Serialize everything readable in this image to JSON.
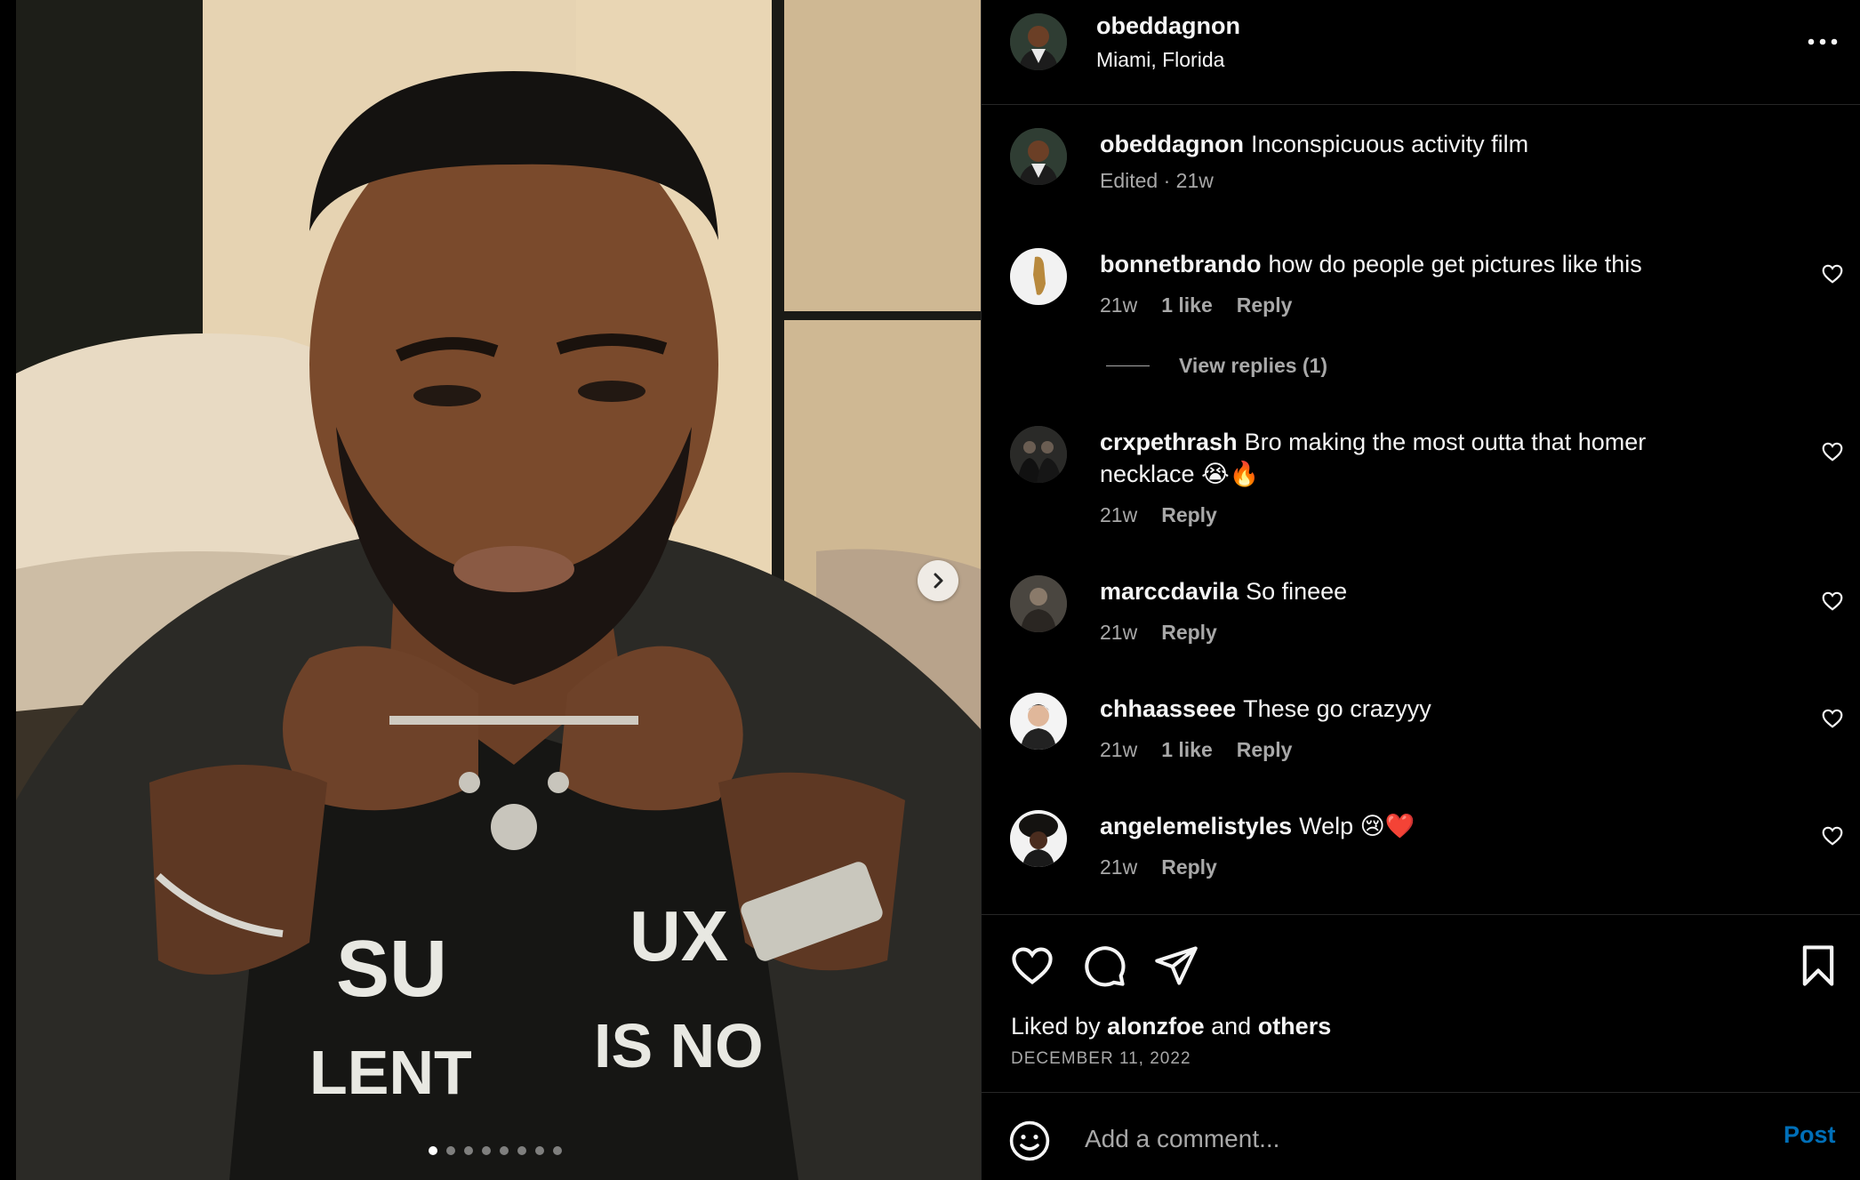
{
  "post": {
    "username": "obeddagnon",
    "location": "Miami, Florida",
    "caption_user": "obeddagnon",
    "caption_text": "Inconspicuous activity film",
    "caption_meta": "Edited · 21w"
  },
  "comments": [
    {
      "user": "bonnetbrando",
      "text": "how do people get pictures like this",
      "age": "21w",
      "likes": "1 like",
      "reply": "Reply"
    },
    {
      "user": "crxpethrash",
      "text": "Bro making the most outta that homer necklace 😭🔥",
      "age": "21w",
      "likes": "",
      "reply": "Reply"
    },
    {
      "user": "marccdavila",
      "text": "So fineee",
      "age": "21w",
      "likes": "",
      "reply": "Reply"
    },
    {
      "user": "chhaasseee",
      "text": "These go crazyyy",
      "age": "21w",
      "likes": "1 like",
      "reply": "Reply"
    },
    {
      "user": "angelemelistyles",
      "text": "Welp 😢❤️",
      "age": "21w",
      "likes": "",
      "reply": "Reply"
    }
  ],
  "view_replies": "View replies (1)",
  "likes": {
    "prefix": "Liked by",
    "user": "alonzfoe",
    "middle": "and",
    "others": "others"
  },
  "date": "DECEMBER 11, 2022",
  "comment_box": {
    "placeholder": "Add a comment...",
    "post_label": "Post"
  },
  "icons": {
    "more": "more-horizontal-icon",
    "next": "chevron-right-icon",
    "like": "heart-icon",
    "comment": "comment-bubble-icon",
    "share": "paper-plane-icon",
    "save": "bookmark-icon",
    "emoji": "smiley-icon"
  },
  "colors": {
    "background": "#000000",
    "text": "#f5f5f5",
    "secondary": "#a8a8a8",
    "divider": "#262626",
    "link": "#0095f6"
  },
  "carousel": {
    "count": 8,
    "active": 1
  }
}
